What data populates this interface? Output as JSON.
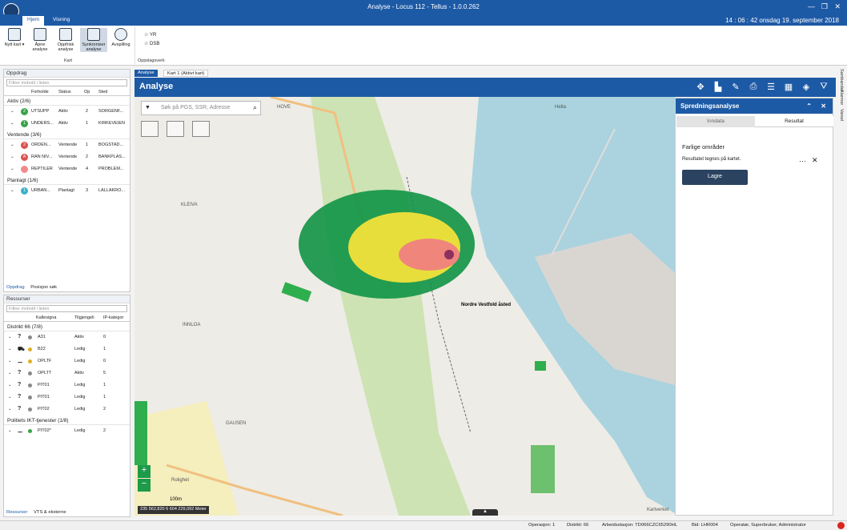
{
  "window": {
    "title": "Analyse - Locus 112 - Tellus - 1.0.0.262",
    "clock": "14 : 06 : 42 onsdag 19. september 2018"
  },
  "ribbon_tabs": [
    "Hjem",
    "Visning"
  ],
  "ribbon": {
    "buttons": [
      {
        "label": "Nytt kart ▾",
        "icon": "new-map-icon"
      },
      {
        "label": "Åpne analyse",
        "icon": "globe-icon"
      },
      {
        "label": "Oppfrisk analyse",
        "icon": "refresh-icon"
      },
      {
        "label": "Synkroniser analyse",
        "icon": "sync-icon"
      },
      {
        "label": "Avspilling",
        "icon": "playback-icon"
      }
    ],
    "group_kart": "Kart",
    "lookup": [
      "YR",
      "DSB"
    ],
    "group_lookup": "Oppslagsverk"
  },
  "oppdrag": {
    "title": "Oppdrag",
    "filter_placeholder": "Filtrer innhold i listen",
    "columns": [
      "Forholde",
      "Status",
      "Op",
      "Sted"
    ],
    "groups": [
      {
        "label": "Aktiv (2/6)",
        "rows": [
          {
            "badge": "2",
            "color": "#3aa34a",
            "name": "UTSUPP",
            "status": "Aktiv",
            "op": "2",
            "sted": "SORGENF..."
          },
          {
            "badge": "1",
            "color": "#3aa34a",
            "name": "UNDERS...",
            "status": "Aktiv",
            "op": "1",
            "sted": "KIRKEVEIEN"
          }
        ]
      },
      {
        "label": "Ventende (3/6)",
        "rows": [
          {
            "badge": "2",
            "color": "#d9534f",
            "name": "ORDEN...",
            "status": "Ventende",
            "op": "1",
            "sted": "BOGSTAD..."
          },
          {
            "badge": "A",
            "color": "#d9534f",
            "name": "RAN NIV...",
            "status": "Ventende",
            "op": "2",
            "sted": "BANKPLAS..."
          },
          {
            "badge": "",
            "color": "#f08a8a",
            "name": "REPTILER",
            "status": "Ventende",
            "op": "4",
            "sted": "PROBLEM..."
          }
        ]
      },
      {
        "label": "Planlagt (1/6)",
        "rows": [
          {
            "badge": "1",
            "color": "#3ab0c8",
            "name": "URBAN...",
            "status": "Planlagt",
            "op": "3",
            "sted": "LALLAKRO..."
          }
        ]
      }
    ],
    "tabs": [
      "Oppdrag",
      "Posisjon søk"
    ]
  },
  "ressurser": {
    "title": "Ressurser",
    "filter_placeholder": "Filtrer innhold i listen",
    "columns": [
      "Kallesigna",
      "Tilgjengeli",
      "IP-kategor"
    ],
    "groups": [
      {
        "label": "Distrikt 66 (7/8)",
        "rows": [
          {
            "sym": "?",
            "dot": "#888",
            "name": "A31",
            "status": "Aktiv",
            "ip": "0"
          },
          {
            "sym": "⛟",
            "dot": "#e0b020",
            "name": "B22",
            "status": "Ledig",
            "ip": "1"
          },
          {
            "sym": "⚊",
            "dot": "#e0b020",
            "name": "OPLTF",
            "status": "Ledig",
            "ip": "0"
          },
          {
            "sym": "?",
            "dot": "#888",
            "name": "OPLTT",
            "status": "Aktiv",
            "ip": "5"
          },
          {
            "sym": "?",
            "dot": "#888",
            "name": "PIT01",
            "status": "Ledig",
            "ip": "1"
          },
          {
            "sym": "?",
            "dot": "#888",
            "name": "PIT01",
            "status": "Ledig",
            "ip": "1"
          },
          {
            "sym": "?",
            "dot": "#888",
            "name": "PIT02",
            "status": "Ledig",
            "ip": "2"
          }
        ]
      },
      {
        "label": "Politiets IKT-tjenester (1/8)",
        "rows": [
          {
            "sym": "⚊",
            "dot": "#3aa34a",
            "name": "PIT02*",
            "status": "Ledig",
            "ip": "2"
          }
        ]
      }
    ],
    "tabs": [
      "Ressurser",
      "VTS & eksterne"
    ]
  },
  "doc_tabs": [
    "Analyse",
    "Kart 1 (Aktivt kart)"
  ],
  "mapbar": {
    "title": "Analyse"
  },
  "map": {
    "search_placeholder": "Søk på PGS, SSR, Adresse",
    "scale": "100m",
    "coords": "235 562,820 6 604 229,092 Meter",
    "place_labels": [
      "HOVE",
      "KLEIVA",
      "INNLOA",
      "GAUSEN",
      "Nordre Vestfold åsted",
      "Helta",
      "Kartverket",
      "Rolighet"
    ],
    "zoom_in": "+",
    "zoom_out": "−"
  },
  "spredning": {
    "title": "Spredningsanalyse",
    "tabs": [
      "Inndata",
      "Resultat"
    ],
    "heading": "Farlige områder",
    "text": "Resultatet tegnes på kartet.",
    "button": "Lagre"
  },
  "right_rail": [
    "Sambandet",
    "Alarmer",
    "Varsel"
  ],
  "status": {
    "operasjon": "Operasjon: 1",
    "distrikt": "Distrikt: 66",
    "arbeidsstasjon": "Arbeidsstasjon: TD066CZC65290HL",
    "bid": "Bid: LHR004",
    "operator": "Operatør, Superbruker, Administrator"
  }
}
